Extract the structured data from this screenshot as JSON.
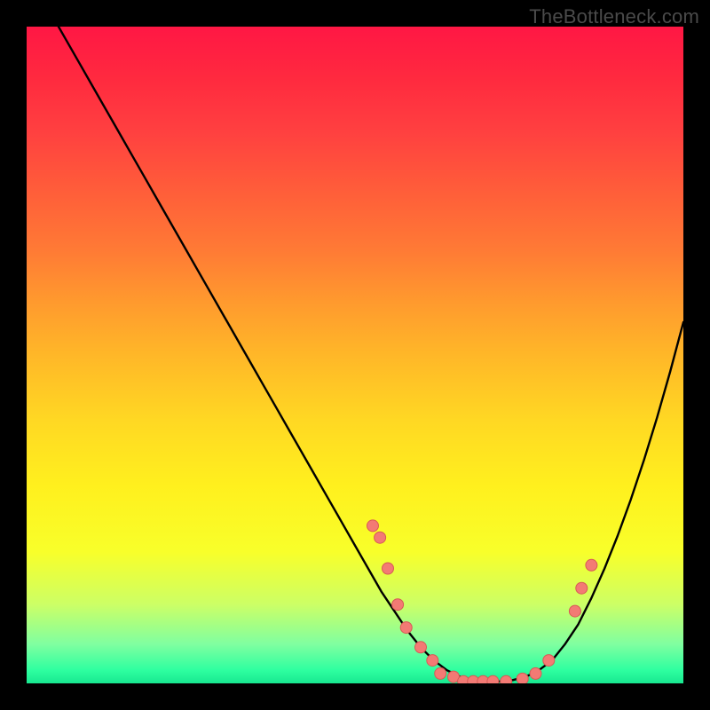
{
  "watermark": "TheBottleneck.com",
  "colors": {
    "curve_stroke": "#000000",
    "dot_fill": "#f37a74",
    "dot_stroke": "#d85a55",
    "gradient_top": "#ff1744",
    "gradient_bottom": "#18e890"
  },
  "chart_data": {
    "type": "line",
    "title": "",
    "xlabel": "",
    "ylabel": "",
    "xlim": [
      0,
      100
    ],
    "ylim": [
      0,
      100
    ],
    "grid": false,
    "legend": false,
    "series": [
      {
        "name": "bottleneck_curve",
        "x": [
          0,
          2,
          4,
          6,
          8,
          10,
          12,
          14,
          16,
          18,
          20,
          22,
          24,
          26,
          28,
          30,
          32,
          34,
          36,
          38,
          40,
          42,
          44,
          46,
          48,
          50,
          52,
          54,
          56,
          58,
          60,
          62,
          64,
          66,
          68,
          70,
          72,
          74,
          76,
          78,
          80,
          82,
          84,
          86,
          88,
          90,
          92,
          94,
          96,
          98,
          100
        ],
        "y": [
          108,
          105,
          101.5,
          98,
          94.5,
          91,
          87.5,
          84,
          80.5,
          77,
          73.5,
          70,
          66.5,
          63,
          59.5,
          56,
          52.5,
          49,
          45.5,
          42,
          38.5,
          35,
          31.5,
          28,
          24.5,
          21,
          17.5,
          14,
          11,
          8,
          5.5,
          3.5,
          2,
          1,
          0.5,
          0.3,
          0.3,
          0.5,
          1,
          2,
          3.5,
          6,
          9,
          13,
          17.5,
          22.5,
          28,
          34,
          40.5,
          47.5,
          55
        ]
      }
    ],
    "dots": [
      {
        "x": 52.7,
        "y": 24.0
      },
      {
        "x": 53.8,
        "y": 22.2
      },
      {
        "x": 55.0,
        "y": 17.5
      },
      {
        "x": 56.5,
        "y": 12.0
      },
      {
        "x": 57.8,
        "y": 8.5
      },
      {
        "x": 60.0,
        "y": 5.5
      },
      {
        "x": 61.8,
        "y": 3.5
      },
      {
        "x": 63.0,
        "y": 1.5
      },
      {
        "x": 65.0,
        "y": 1.0
      },
      {
        "x": 66.5,
        "y": 0.3
      },
      {
        "x": 68.0,
        "y": 0.3
      },
      {
        "x": 69.5,
        "y": 0.3
      },
      {
        "x": 71.0,
        "y": 0.3
      },
      {
        "x": 73.0,
        "y": 0.3
      },
      {
        "x": 75.5,
        "y": 0.7
      },
      {
        "x": 77.5,
        "y": 1.5
      },
      {
        "x": 79.5,
        "y": 3.5
      },
      {
        "x": 83.5,
        "y": 11.0
      },
      {
        "x": 84.5,
        "y": 14.5
      },
      {
        "x": 86.0,
        "y": 18.0
      }
    ]
  }
}
